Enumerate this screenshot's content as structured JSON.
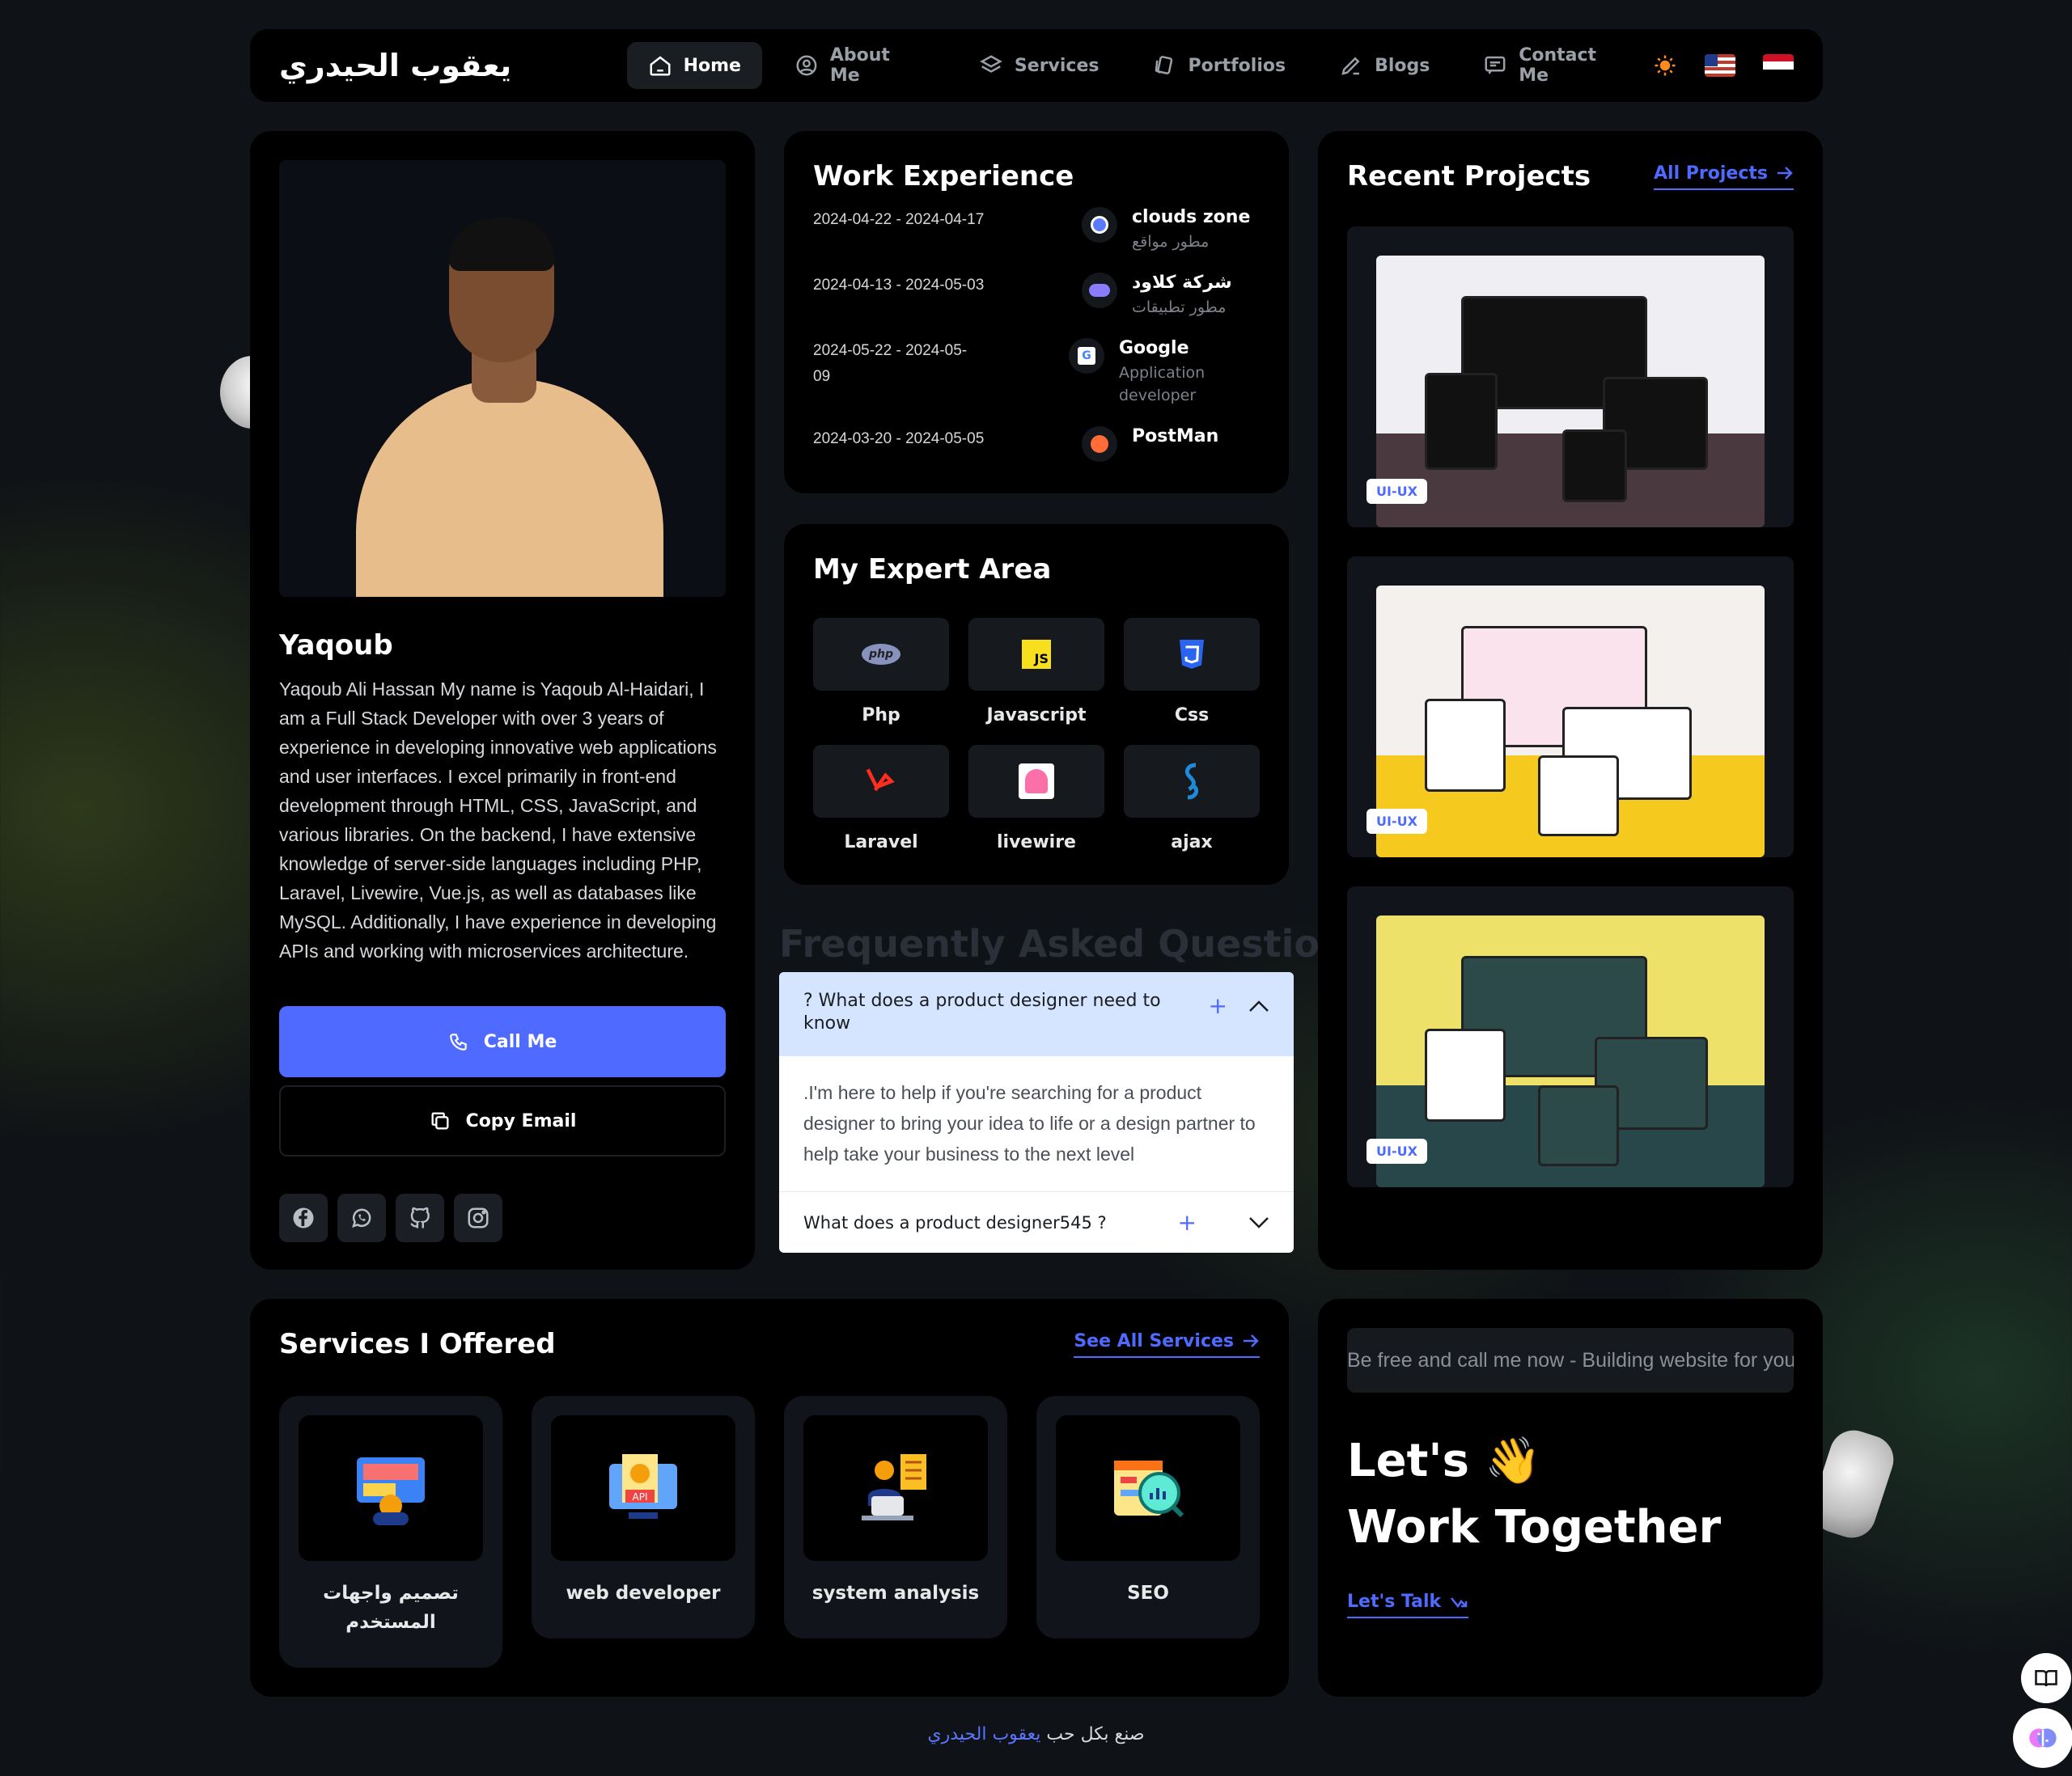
{
  "nav": {
    "logo": "يعقوب الحيدري",
    "links": [
      {
        "label": "Home",
        "icon": "home-icon"
      },
      {
        "label": "About Me",
        "icon": "user-icon"
      },
      {
        "label": "Services",
        "icon": "layers-icon"
      },
      {
        "label": "Portfolios",
        "icon": "cards-icon"
      },
      {
        "label": "Blogs",
        "icon": "edit-icon"
      },
      {
        "label": "Contact Me",
        "icon": "message-icon"
      }
    ],
    "active": "Home"
  },
  "profile": {
    "name": "Yaqoub",
    "bio": "Yaqoub Ali Hassan My name is Yaqoub Al-Haidari, I am a Full Stack Developer with over 3 years of experience in developing innovative web applications and user interfaces. I excel primarily in front-end development through HTML, CSS, JavaScript, and various libraries. On the backend, I have extensive knowledge of server-side languages including PHP, Laravel, Livewire, Vue.js, as well as databases like MySQL. Additionally, I have experience in developing APIs and working with microservices architecture.",
    "call_label": "Call Me",
    "copy_label": "Copy Email",
    "socials": [
      "facebook-icon",
      "whatsapp-icon",
      "github-icon",
      "instagram-icon"
    ]
  },
  "work": {
    "title": "Work Experience",
    "items": [
      {
        "date": "2024-04-22 - 2024-04-17",
        "company": "clouds zone",
        "role": "مطور مواقع"
      },
      {
        "date": "2024-04-13 - 2024-05-03",
        "company": "شركة كلاود",
        "role": "مطور تطبيقات"
      },
      {
        "date": "2024-05-22 - 2024-05-09",
        "company": "Google",
        "role": "Application developer"
      },
      {
        "date": "2024-03-20 - 2024-05-05",
        "company": "PostMan",
        "role": ""
      }
    ]
  },
  "expert": {
    "title": "My Expert Area",
    "skills": [
      {
        "label": "Php",
        "icon": "php-icon"
      },
      {
        "label": "Javascript",
        "icon": "javascript-icon"
      },
      {
        "label": "Css",
        "icon": "css-icon"
      },
      {
        "label": "Laravel",
        "icon": "laravel-icon"
      },
      {
        "label": "livewire",
        "icon": "livewire-icon"
      },
      {
        "label": "ajax",
        "icon": "ajax-icon"
      }
    ]
  },
  "faq": {
    "title": "Frequently Asked Questions",
    "q1": "? What does a product designer need to know",
    "a1": ".I'm here to help if you're searching for a product designer to bring your idea to life or a design partner to help take your business to the next level",
    "q2": "What does a product designer545 ?"
  },
  "projects": {
    "title": "Recent Projects",
    "all_label": "All Projects",
    "items": [
      {
        "badge": "UI-UX",
        "bg": "#efeef2",
        "floor": "#4a3a40"
      },
      {
        "badge": "UI-UX",
        "bg": "#f3f0ee",
        "floor": "#f6c91e"
      },
      {
        "badge": "UI-UX",
        "bg": "#ede16a",
        "floor": "#28474a"
      }
    ]
  },
  "services": {
    "title": "Services I Offered",
    "see_all": "See All Services",
    "items": [
      {
        "label": "تصميم واجهات المستخدم",
        "icon": "ui-design-icon"
      },
      {
        "label": "web developer",
        "icon": "api-monitor-icon"
      },
      {
        "label": "system analysis",
        "icon": "analyst-icon"
      },
      {
        "label": "SEO",
        "icon": "seo-icon"
      }
    ]
  },
  "contact": {
    "marquee": "Be free and call me now - Building website for you",
    "line1": "Let's 👋",
    "line2": "Work Together",
    "talk": "Let's Talk"
  },
  "footer": {
    "name": "يعقوب الحيدري",
    "text": "صنع بكل حب"
  },
  "colors": {
    "accent": "#4f6bff",
    "card": "#000000",
    "page": "#0f1216"
  }
}
